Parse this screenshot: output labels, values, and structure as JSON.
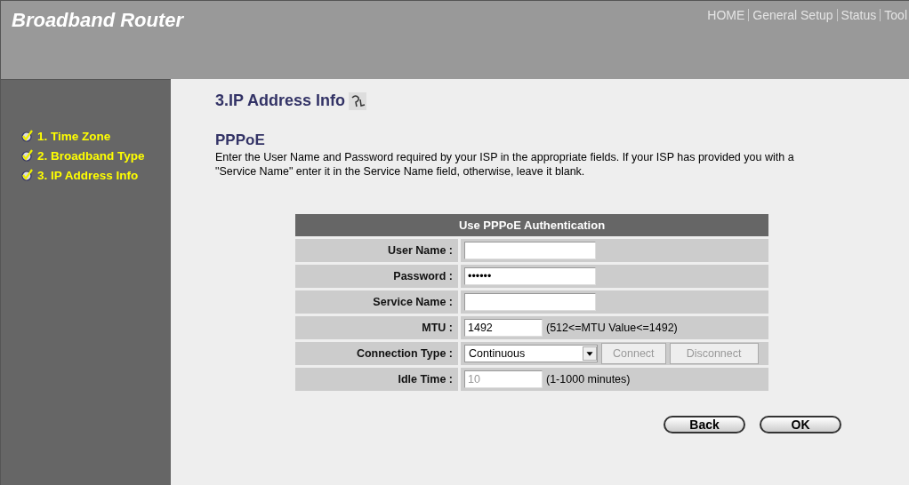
{
  "header": {
    "title": "Broadband Router",
    "nav": [
      {
        "label": "HOME"
      },
      {
        "label": "General Setup"
      },
      {
        "label": "Status"
      },
      {
        "label": "Tool"
      }
    ]
  },
  "sidebar": {
    "items": [
      {
        "label": "1. Time Zone",
        "checked": true
      },
      {
        "label": "2. Broadband Type",
        "checked": true
      },
      {
        "label": "3. IP Address Info",
        "checked": true
      }
    ]
  },
  "page": {
    "title": "3.IP Address Info",
    "section": "PPPoE",
    "description": "Enter the User Name and Password required by your ISP in the appropriate fields. If your ISP has provided you with a \"Service Name\" enter it in the Service Name field, otherwise, leave it blank."
  },
  "form": {
    "title": "Use PPPoE Authentication",
    "rows": [
      {
        "kind": "text",
        "label": "User Name :"
      },
      {
        "kind": "text",
        "label": "Password :",
        "value": "••••••"
      },
      {
        "kind": "text",
        "label": "Service Name :"
      },
      {
        "kind": "short",
        "label": "MTU :",
        "value": "1492",
        "note": "(512<=MTU Value<=1492)",
        "disabled": false
      },
      {
        "kind": "select",
        "label": "Connection Type :",
        "value": "Continuous",
        "buttons": [
          {
            "label": "Connect",
            "disabled": true
          },
          {
            "label": "Disconnect",
            "disabled": true
          }
        ]
      },
      {
        "kind": "short",
        "label": "Idle Time :",
        "value": "10",
        "note": "(1-1000 minutes)",
        "disabled": true
      }
    ]
  },
  "buttons": [
    {
      "label": "Back"
    },
    {
      "label": "OK"
    }
  ]
}
